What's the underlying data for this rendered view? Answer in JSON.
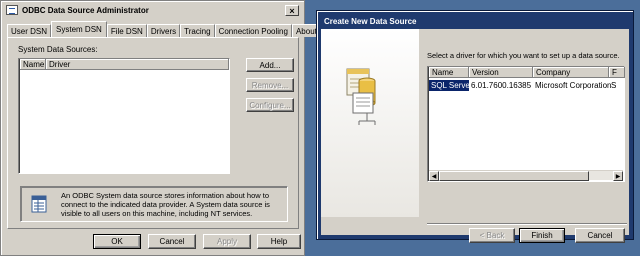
{
  "odbc": {
    "title": "ODBC Data Source Administrator",
    "tabs": [
      "User DSN",
      "System DSN",
      "File DSN",
      "Drivers",
      "Tracing",
      "Connection Pooling",
      "About"
    ],
    "active_tab": "System DSN",
    "list_caption": "System Data Sources:",
    "columns": [
      "Name",
      "Driver"
    ],
    "side_buttons": {
      "add": "Add...",
      "remove": "Remove...",
      "configure": "Configure..."
    },
    "info_text": "An ODBC System data source stores information about how to connect to the indicated data provider.   A System data source is visible to all users on this machine, including NT services.",
    "footer_buttons": {
      "ok": "OK",
      "cancel": "Cancel",
      "apply": "Apply",
      "help": "Help"
    },
    "close_glyph": "×"
  },
  "create_new": {
    "title": "Create New Data Source",
    "prompt": "Select a driver for which you want to set up a data source.",
    "columns": [
      "Name",
      "Version",
      "Company",
      "F"
    ],
    "rows": [
      {
        "name": "SQL Server",
        "version": "6.01.7600.16385",
        "company": "Microsoft Corporation",
        "extra": "S",
        "selected": true
      }
    ],
    "buttons": {
      "back": "< Back",
      "finish": "Finish",
      "cancel": "Cancel"
    }
  }
}
